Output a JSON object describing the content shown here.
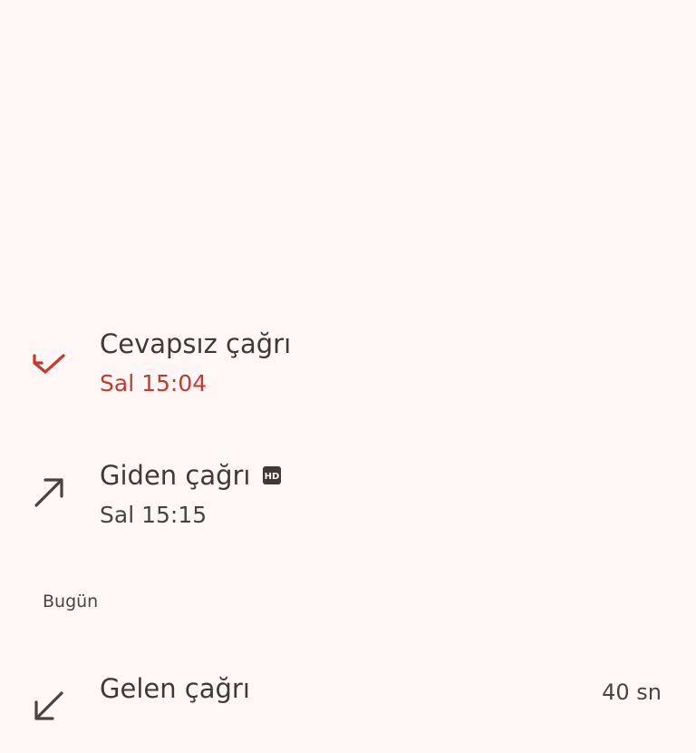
{
  "call_log": {
    "items": [
      {
        "type_label": "Cevapsız çağrı",
        "time": "Sal 15:04",
        "icon": "missed-call-icon",
        "status_color": "#C7392E"
      },
      {
        "type_label": "Giden çağrı",
        "time": "Sal 15:15",
        "icon": "outgoing-call-icon",
        "badge": "HD"
      }
    ],
    "section_today": "Bugün",
    "today_items": [
      {
        "type_label": "Gelen çağrı",
        "duration": "40 sn",
        "icon": "incoming-call-icon"
      }
    ]
  }
}
